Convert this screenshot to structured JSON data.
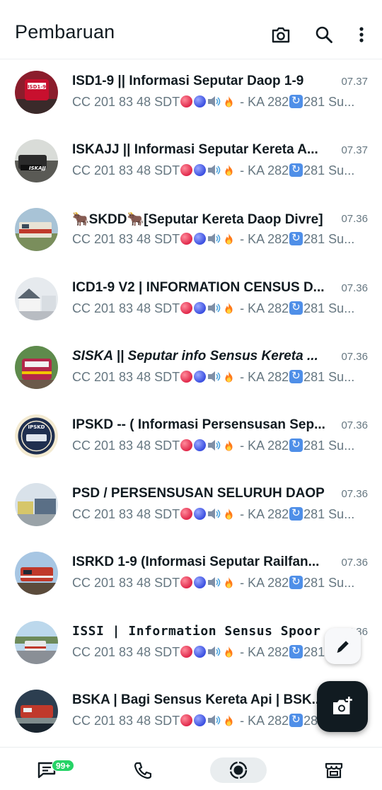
{
  "header": {
    "title": "Pembaruan",
    "icons": [
      "camera-icon",
      "search-icon",
      "more-vertical-icon"
    ]
  },
  "channels": [
    {
      "name": "ISD1-9 || Informasi Seputar Daop 1-9",
      "time": "07.37",
      "preview_start": "CC 201 83 48 SDT",
      "preview_end": " - KA 282",
      "preview_tail": "281 Su...",
      "avatar_color": "#8b1d2c"
    },
    {
      "name": "ISKAJJ || Informasi Seputar Kereta A...",
      "time": "07.37",
      "preview_start": "CC 201 83 48 SDT",
      "preview_end": " - KA 282",
      "preview_tail": "281 Su...",
      "avatar_color": "#5a5a55"
    },
    {
      "name": "🐂SKDD🐂[Seputar Kereta Daop Divre]",
      "time": "07.36",
      "preview_start": "CC 201 83 48 SDT",
      "preview_end": " - KA 282",
      "preview_tail": "281 Su...",
      "avatar_color": "#7a8e5c"
    },
    {
      "name": "ICD1-9 V2 | INFORMATION CENSUS D...",
      "time": "07.36",
      "preview_start": "CC 201 83 48 SDT",
      "preview_end": " - KA 282",
      "preview_tail": "281 Su...",
      "avatar_color": "#b8bcc2"
    },
    {
      "name": "SISKA || Seputar info Sensus Kereta ...",
      "time": "07.36",
      "preview_start": "CC 201 83 48 SDT",
      "preview_end": " - KA 282",
      "preview_tail": "281 Su...",
      "avatar_color": "#6a8a4a"
    },
    {
      "name": "IPSKD -- ( Informasi Persensusan Sep...",
      "time": "07.36",
      "preview_start": "CC 201 83 48 SDT",
      "preview_end": " - KA 282",
      "preview_tail": "281 Su...",
      "avatar_color": "#1f2f4f"
    },
    {
      "name": "PSD / PERSENSUSAN SELURUH DAOP",
      "time": "07.36",
      "preview_start": "CC 201 83 48 SDT",
      "preview_end": " - KA 282",
      "preview_tail": "281 Su...",
      "avatar_color": "#9aa3a8"
    },
    {
      "name": "ISRKD 1-9 (Informasi Seputar Railfan...",
      "time": "07.36",
      "preview_start": "CC 201 83 48 SDT",
      "preview_end": " - KA 282",
      "preview_tail": "281 Su...",
      "avatar_color": "#c0392b"
    },
    {
      "name": "ISSI | Information Sensus Spoor",
      "time": "07.36",
      "preview_start": "CC 201 83 48 SDT",
      "preview_end": " - KA 282",
      "preview_tail": "281 Su...",
      "avatar_color": "#4a7fb5"
    },
    {
      "name": "BSKA | Bagi Sensus Kereta Api | BSK...",
      "time": "",
      "preview_start": "CC 201 83 48 SDT",
      "preview_end": " - KA 282",
      "preview_tail": "281 Su...",
      "avatar_color": "#2c3e50"
    }
  ],
  "fabs": {
    "small_icon": "pencil-icon",
    "big_icon": "camera-plus-icon"
  },
  "bottom_nav": {
    "chats_badge": "99+",
    "items": [
      "chats-icon",
      "calls-icon",
      "updates-icon",
      "communities-store-icon"
    ]
  }
}
